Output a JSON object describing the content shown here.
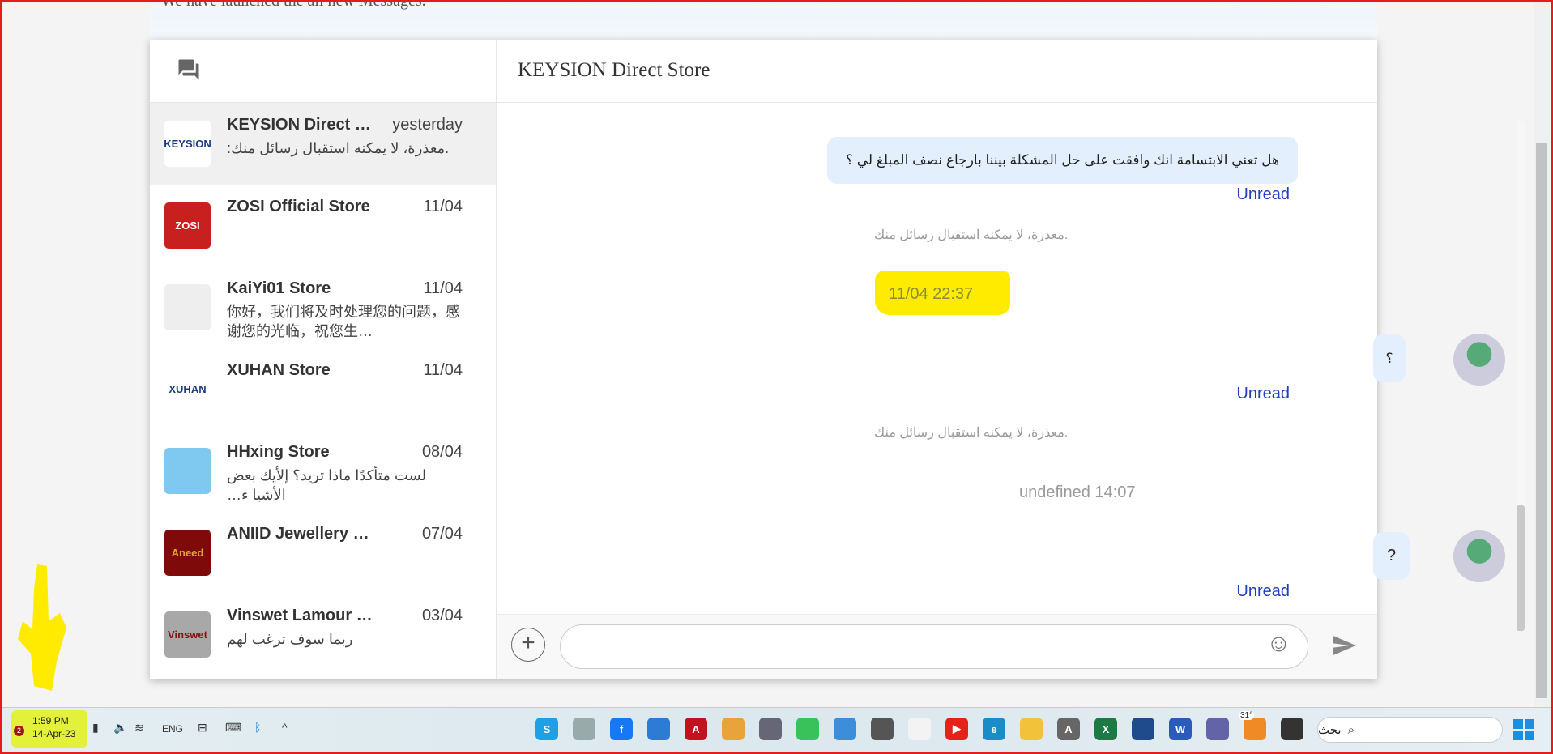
{
  "banner": {
    "text": "We have launched the all new Messages."
  },
  "sidebar": {
    "header_icon": "chat-bubbles-icon",
    "items": [
      {
        "name": "KEYSION Direct Store",
        "date": "yesterday",
        "preview": ".معذرة، لا يمكنه استقبال رسائل منك:",
        "logo": "KEYSION",
        "color": "#ffffff",
        "selected": true
      },
      {
        "name": "ZOSI Official Store",
        "date": "11/04",
        "preview": "",
        "logo": "ZOSI",
        "color": "#c8201f"
      },
      {
        "name": "KaiYi01 Store",
        "date": "11/04",
        "preview": "你好，我们将及时处理您的问题，感谢您的光临，祝您生…",
        "logo": "",
        "color": "#eeeeee"
      },
      {
        "name": "XUHAN Store",
        "date": "11/04",
        "preview": "",
        "logo": "XUHAN",
        "color": "#ffffff"
      },
      {
        "name": "HHxing Store",
        "date": "08/04",
        "preview": "لست متأكدًا ماذا تريد؟ إلأيك بعض الأشيا ء…",
        "logo": "",
        "color": "#7fc8ef"
      },
      {
        "name": "ANIID Jewellery Official Store",
        "date": "07/04",
        "preview": "",
        "logo": "Aneed",
        "color": "#7f0a0a"
      },
      {
        "name": "Vinswet Lamour Store",
        "date": "03/04",
        "preview": "ربما سوف ترغب لهم",
        "logo": "Vinswet",
        "color": "#a8a8a8"
      }
    ]
  },
  "chat": {
    "title": "KEYSION Direct Store",
    "msg1": "هل تعني الابتسامة انك وافقت على حل المشكلة بيننا بارجاع نصف المبلغ لي ؟",
    "unread": "Unread",
    "system": ".معذرة، لا يمكنه استقبال رسائل منك",
    "time1": "11/04 22:37",
    "msg2": "؟",
    "time2": "undefined 14:07",
    "msg3": "?",
    "input_placeholder": "",
    "highlight_color": "#ffeb00"
  },
  "taskbar": {
    "time": "1:59 PM",
    "date": "14-Apr-23",
    "notifications": "2",
    "lang": "ENG",
    "weather": "31°",
    "search_placeholder": "بحث",
    "apps": [
      {
        "n": "skype",
        "c": "#1ea0e6",
        "l": "S"
      },
      {
        "n": "scanner",
        "c": "#9aa",
        "l": ""
      },
      {
        "n": "facebook",
        "c": "#1877f2",
        "l": "f"
      },
      {
        "n": "photos",
        "c": "#2e7bd6",
        "l": ""
      },
      {
        "n": "acrobat",
        "c": "#c1121f",
        "l": "A"
      },
      {
        "n": "chrome",
        "c": "#e8a33a",
        "l": ""
      },
      {
        "n": "settings",
        "c": "#667",
        "l": ""
      },
      {
        "n": "wechat",
        "c": "#39c15a",
        "l": ""
      },
      {
        "n": "notepad",
        "c": "#3c8ed8",
        "l": ""
      },
      {
        "n": "calculator",
        "c": "#555",
        "l": ""
      },
      {
        "n": "snipping-tool",
        "c": "#f3f3f3",
        "l": ""
      },
      {
        "n": "youtube",
        "c": "#e62117",
        "l": "▶"
      },
      {
        "n": "edge",
        "c": "#1a8cc8",
        "l": "e"
      },
      {
        "n": "file-explorer",
        "c": "#f2c33a",
        "l": ""
      },
      {
        "n": "font-app",
        "c": "#666",
        "l": "A"
      },
      {
        "n": "excel",
        "c": "#1d7a45",
        "l": "X"
      },
      {
        "n": "store",
        "c": "#1f4a8c",
        "l": ""
      },
      {
        "n": "word",
        "c": "#2b5bb8",
        "l": "W"
      },
      {
        "n": "teams",
        "c": "#6264a7",
        "l": ""
      },
      {
        "n": "weather",
        "c": "#f08a24",
        "l": ""
      },
      {
        "n": "task-view",
        "c": "#333",
        "l": ""
      }
    ]
  }
}
